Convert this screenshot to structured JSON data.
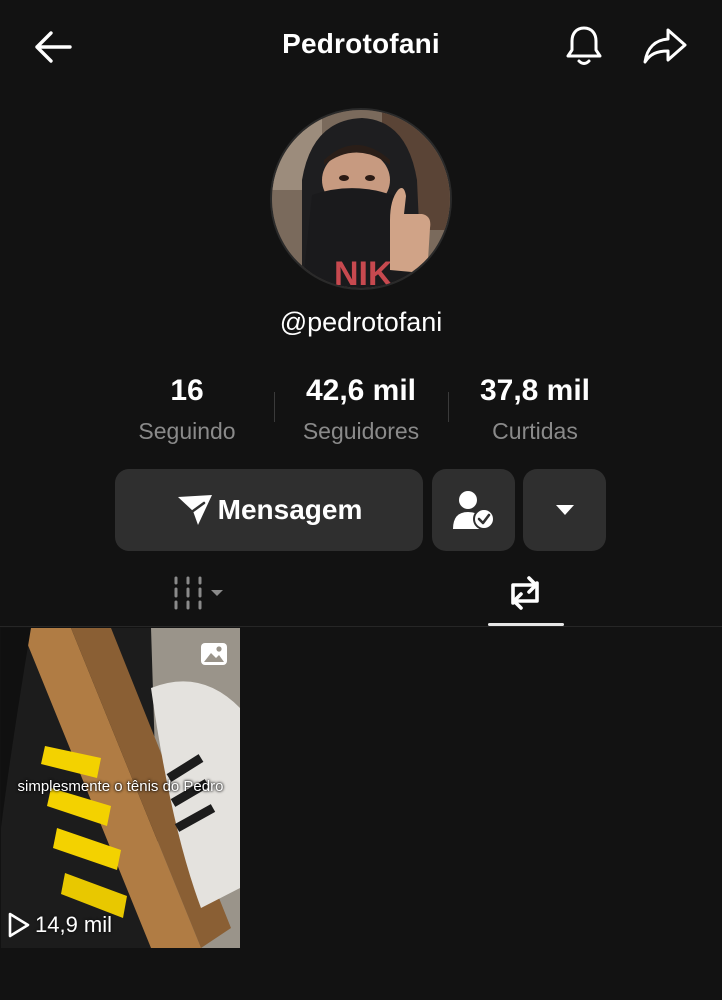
{
  "header": {
    "title": "Pedrotofani",
    "back_icon": "arrow-left-icon",
    "bell_icon": "bell-icon",
    "share_icon": "share-arrow-icon"
  },
  "profile": {
    "username": "@pedrotofani",
    "stats": [
      {
        "value": "16",
        "label": "Seguindo"
      },
      {
        "value": "42,6 mil",
        "label": "Seguidores"
      },
      {
        "value": "37,8 mil",
        "label": "Curtidas"
      }
    ]
  },
  "actions": {
    "message_label": "Mensagem",
    "message_icon": "send-icon",
    "following_icon": "user-check-icon",
    "more_icon": "caret-down-icon"
  },
  "tabs": [
    {
      "name": "videos-grid",
      "icon": "grid-icon",
      "active": false
    },
    {
      "name": "reposts",
      "icon": "repost-icon",
      "active": true
    }
  ],
  "videos": [
    {
      "caption": "simplesmente o tênis do Pedro",
      "views": "14,9 mil",
      "type_icon": "photo-icon"
    }
  ],
  "colors": {
    "background": "#121212",
    "button": "#2f2f2f",
    "secondary_text": "#8a8a8a"
  }
}
